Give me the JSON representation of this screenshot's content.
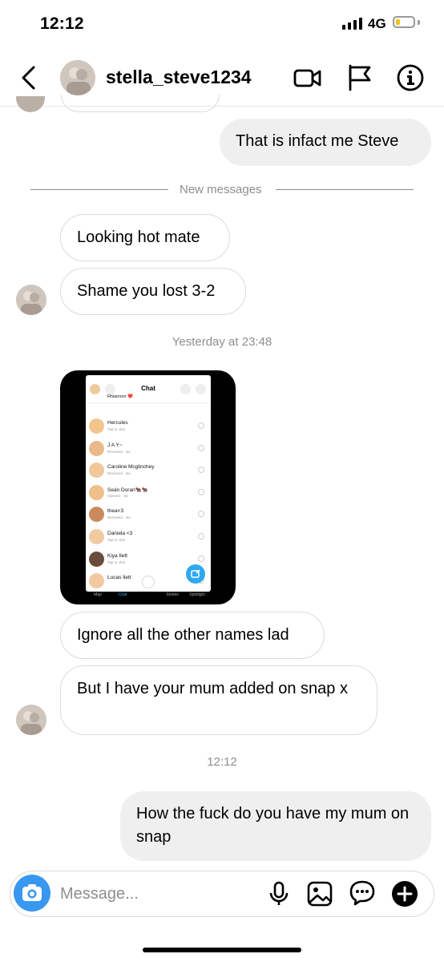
{
  "status_bar": {
    "time": "12:12",
    "network": "4G",
    "battery_color": "#f4c20d",
    "battery_level": 0.2
  },
  "header": {
    "username": "stella_steve1234",
    "icons": [
      "back-icon",
      "video-call-icon",
      "flag-icon",
      "info-icon"
    ]
  },
  "messages": {
    "m1": "That is infact me Steve",
    "new_messages_label": "New messages",
    "m2": "Looking hot mate",
    "m3": "Shame you lost 3-2",
    "ts1": "Yesterday at 23:48",
    "m4": "Ignore all the other names lad",
    "m5": "But I have your mum added on snap x",
    "ts2": "12:12",
    "m6": "How the fuck do you have my mum on snap"
  },
  "shared_screenshot": {
    "title": "Chat",
    "top_partial": "Rhiannon ❤️",
    "top_partial_sub": "Tap to chat",
    "rows": [
      {
        "name": "Hercules",
        "sub": "Tap to chat"
      },
      {
        "name": "J A Y~",
        "sub": "Received · 3w"
      },
      {
        "name": "Caroline Mcglinchey",
        "sub": "Received · 3w"
      },
      {
        "name": "Seán Doran🐂🐂",
        "sub": "Opened · 3w"
      },
      {
        "name": "thea<3",
        "sub": "Received · 3w"
      },
      {
        "name": "Daniela <3",
        "sub": "Tap to chat"
      },
      {
        "name": "Kiya Ilett",
        "sub": "Tap to chat"
      },
      {
        "name": "Lucas Ilett",
        "sub": ""
      }
    ],
    "nav": [
      "Map",
      "Chat",
      "",
      "Stories",
      "Spotlight"
    ],
    "accent": "#2ea9f0"
  },
  "composer": {
    "placeholder": "Message...",
    "accent": "#3897f0",
    "icons": [
      "camera-icon",
      "microphone-icon",
      "gallery-icon",
      "sticker-icon",
      "plus-icon"
    ]
  }
}
